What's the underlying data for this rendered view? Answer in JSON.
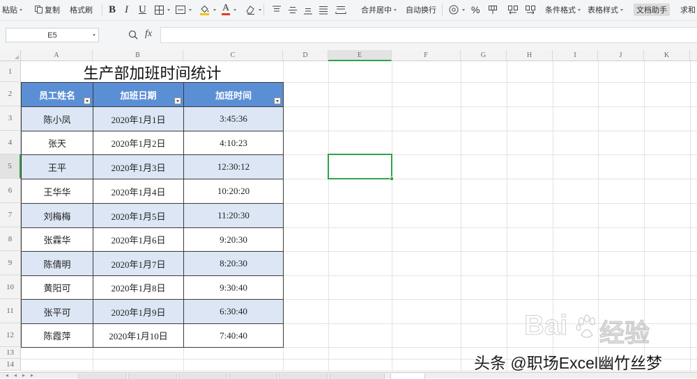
{
  "toolbar": {
    "paste_label": "粘贴",
    "copy_label": "复制",
    "format_painter_label": "格式刷",
    "bold_label": "B",
    "italic_label": "I",
    "underline_label": "U",
    "font_color_letter": "A",
    "merge_center_label": "合并居中",
    "wrap_text_label": "自动换行",
    "percent_label": "%",
    "conditional_format_label": "条件格式",
    "table_style_label": "表格样式",
    "doc_assistant_label": "文档助手",
    "sum_label": "求和"
  },
  "formula_bar": {
    "name_box_value": "E5",
    "fx_label": "fx",
    "formula_value": ""
  },
  "sheet": {
    "columns": [
      "A",
      "B",
      "C",
      "D",
      "E",
      "F",
      "G",
      "H",
      "I",
      "J",
      "K"
    ],
    "row_numbers": [
      "1",
      "2",
      "3",
      "4",
      "5",
      "6",
      "7",
      "8",
      "9",
      "10",
      "11",
      "12",
      "13",
      "14"
    ]
  },
  "table": {
    "title": "生产部加班时间统计",
    "headers": [
      "员工姓名",
      "加班日期",
      "加班时间"
    ],
    "rows": [
      [
        "陈小凤",
        "2020年1月1日",
        "3:45:36"
      ],
      [
        "张天",
        "2020年1月2日",
        "4:10:23"
      ],
      [
        "王平",
        "2020年1月3日",
        "12:30:12"
      ],
      [
        "王华华",
        "2020年1月4日",
        "10:20:20"
      ],
      [
        "刘梅梅",
        "2020年1月5日",
        "11:20:30"
      ],
      [
        "张霖华",
        "2020年1月6日",
        "9:20:30"
      ],
      [
        "陈倩明",
        "2020年1月7日",
        "8:20:30"
      ],
      [
        "黄阳可",
        "2020年1月8日",
        "9:30:40"
      ],
      [
        "张平可",
        "2020年1月9日",
        "6:30:40"
      ],
      [
        "陈霞萍",
        "2020年1月10日",
        "7:40:40"
      ]
    ]
  },
  "colors": {
    "header_fill": "#5b8fd5",
    "header_text": "#ffffff",
    "band_fill": "#dce6f4",
    "plain_fill": "#ffffff",
    "table_border": "#3a3a3a",
    "gridline": "#e3e3e3",
    "selection": "#2ea346",
    "font_color_bar": "#e03a2f",
    "fill_color_bar": "#f2c40a"
  },
  "watermarks": {
    "baidu_logo_latin": "Bai",
    "baidu_logo_cn": "经验",
    "toutiao_caption": "头条 @职场Excel幽竹丝梦"
  }
}
